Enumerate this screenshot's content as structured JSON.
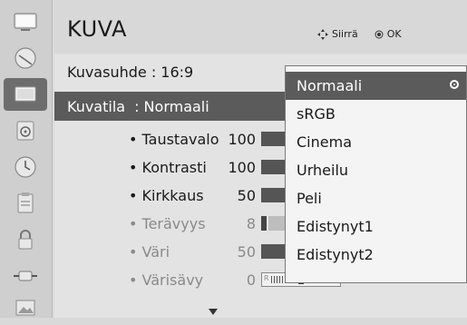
{
  "header": {
    "title": "KUVA",
    "move_label": "Siirrä",
    "ok_label": "OK"
  },
  "picture": {
    "aspect_ratio_text": "Kuvasuhde : 16:9",
    "picture_mode_key": "Kuvatila",
    "picture_mode_value": ": Normaali"
  },
  "settings": [
    {
      "name": "• Taustavalo",
      "value": "100"
    },
    {
      "name": "• Kontrasti",
      "value": "100"
    },
    {
      "name": "• Kirkkaus",
      "value": "50"
    },
    {
      "name": "• Terävyys",
      "value": "8"
    },
    {
      "name": "• Väri",
      "value": "50"
    },
    {
      "name": "• Värisävy",
      "value": "0"
    }
  ],
  "tint_scale": {
    "left": "R",
    "right": "G"
  },
  "dropdown": {
    "options": [
      "Normaali",
      "sRGB",
      "Cinema",
      "Urheilu",
      "Peli",
      "Edistynyt1",
      "Edistynyt2"
    ],
    "selected": "Normaali"
  }
}
